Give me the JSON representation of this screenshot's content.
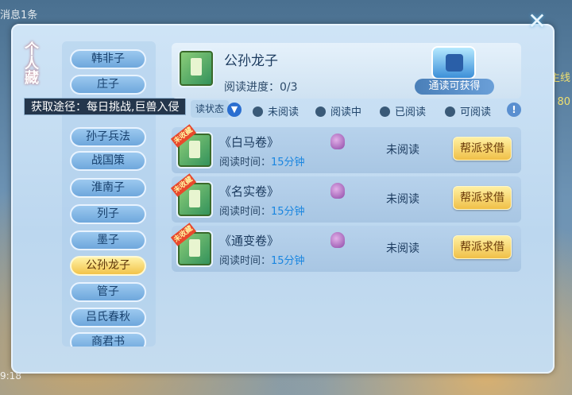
{
  "background": {
    "top_left_text": "消息1条",
    "bottom_left_time": "9:18",
    "right_labels": [
      "主线",
      "80"
    ]
  },
  "panel": {
    "title": "个人藏",
    "tooltip": "获取途径：每日挑战,巨兽入侵",
    "sidebar": {
      "items": [
        "韩非子",
        "庄子",
        "孙子兵法",
        "战国策",
        "淮南子",
        "列子",
        "墨子",
        "公孙龙子",
        "管子",
        "吕氏春秋",
        "商君书"
      ],
      "selected": "公孙龙子"
    },
    "header": {
      "book_title": "公孙龙子",
      "progress_label": "阅读进度：",
      "progress_value": "0/3",
      "progress_fraction": 0.0,
      "reward_label": "通读可获得"
    },
    "filter": {
      "label": "读状态",
      "options": [
        "未阅读",
        "阅读中",
        "已阅读",
        "可阅读"
      ]
    },
    "rows": [
      {
        "ribbon": "未收藏",
        "title": "《白马卷》",
        "time_label": "阅读时间：",
        "time_value": "15分钟",
        "status": "未阅读",
        "button": "帮派求借"
      },
      {
        "ribbon": "未收藏",
        "title": "《名实卷》",
        "time_label": "阅读时间：",
        "time_value": "15分钟",
        "status": "未阅读",
        "button": "帮派求借"
      },
      {
        "ribbon": "未收藏",
        "title": "《通变卷》",
        "time_label": "阅读时间：",
        "time_value": "15分钟",
        "status": "未阅读",
        "button": "帮派求借"
      }
    ]
  },
  "colors": {
    "accent": "#f0c048",
    "panel": "#cfe4f6",
    "link_blue": "#1a86e0"
  }
}
